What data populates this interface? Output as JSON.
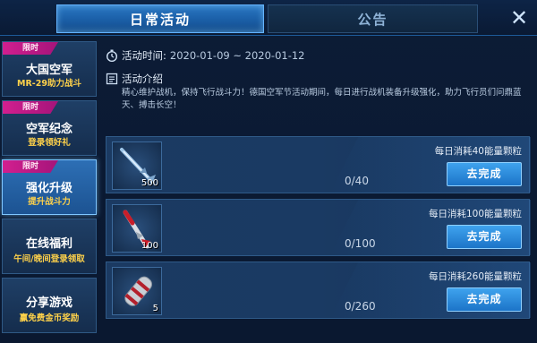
{
  "tabs": {
    "daily": "日常活动",
    "notice": "公告"
  },
  "close_symbol": "✕",
  "sidebar": {
    "items": [
      {
        "tag": "限时",
        "title": "大国空军",
        "subtitle": "MR-29助力战斗"
      },
      {
        "tag": "限时",
        "title": "空军纪念",
        "subtitle": "登录领好礼"
      },
      {
        "tag": "限时",
        "title": "强化升级",
        "subtitle": "提升战斗力",
        "active": true
      },
      {
        "tag": "",
        "title": "在线福利",
        "subtitle": "午间/晚间登录领取"
      },
      {
        "tag": "",
        "title": "分享游戏",
        "subtitle": "赢免费金币奖励"
      }
    ]
  },
  "activity": {
    "time_label": "活动时间:",
    "time_value": "2020-01-09 ~ 2020-01-12",
    "intro_label": "活动介绍",
    "intro_text": "精心维护战机，保持飞行战斗力！德国空军节活动期间，每日进行战机装备升级强化，助力飞行员们问鼎蓝天、搏击长空！"
  },
  "tasks": [
    {
      "icon": "missile-blue-icon",
      "count": "500",
      "progress": "0/40",
      "description": "每日消耗40能量颗粒",
      "button": "去完成"
    },
    {
      "icon": "missile-red-icon",
      "count": "100",
      "progress": "0/100",
      "description": "每日消耗100能量颗粒",
      "button": "去完成"
    },
    {
      "icon": "bomb-pod-icon",
      "count": "5",
      "progress": "0/260",
      "description": "每日消耗260能量颗粒",
      "button": "去完成"
    }
  ],
  "colors": {
    "accent": "#1c74c8",
    "tag": "#d21f8f",
    "subtitle": "#ffd24a"
  }
}
